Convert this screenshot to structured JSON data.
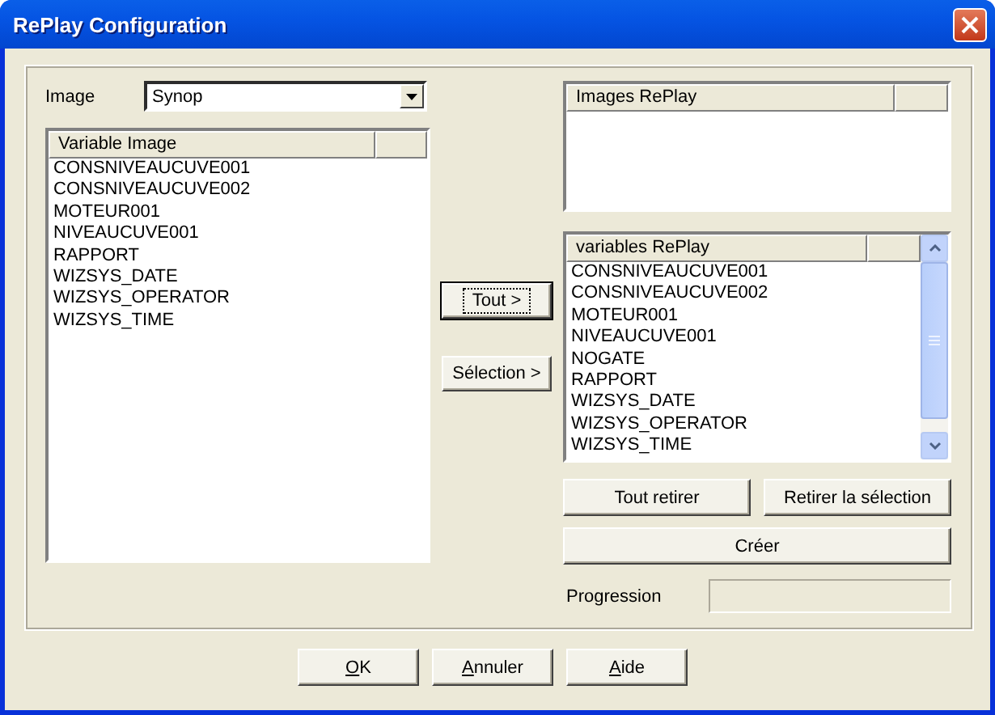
{
  "window": {
    "title": "RePlay Configuration"
  },
  "image": {
    "label": "Image",
    "value": "Synop"
  },
  "variable_image": {
    "column": "Variable Image",
    "items": [
      "CONSNIVEAUCUVE001",
      "CONSNIVEAUCUVE002",
      "MOTEUR001",
      "NIVEAUCUVE001",
      "RAPPORT",
      "WIZSYS_DATE",
      "WIZSYS_OPERATOR",
      "WIZSYS_TIME"
    ]
  },
  "transfer_buttons": [
    {
      "label": "Tout >",
      "focused": true
    },
    {
      "label": "Sélection >",
      "focused": false
    }
  ],
  "images_replay": {
    "column": "Images RePlay"
  },
  "variables_replay": {
    "column": "variables RePlay",
    "items": [
      "CONSNIVEAUCUVE001",
      "CONSNIVEAUCUVE002",
      "MOTEUR001",
      "NIVEAUCUVE001",
      "NOGATE",
      "RAPPORT",
      "WIZSYS_DATE",
      "WIZSYS_OPERATOR",
      "WIZSYS_TIME"
    ]
  },
  "remove_buttons": [
    "Tout retirer",
    "Retirer la sélection"
  ],
  "create_button": "Créer",
  "progression": {
    "label": "Progression",
    "level": 0
  },
  "buttons": [
    {
      "label": "OK",
      "underline_first": true
    },
    {
      "label": "Annuler",
      "underline_first": true
    },
    {
      "label": "Aide",
      "underline_first": true
    }
  ]
}
